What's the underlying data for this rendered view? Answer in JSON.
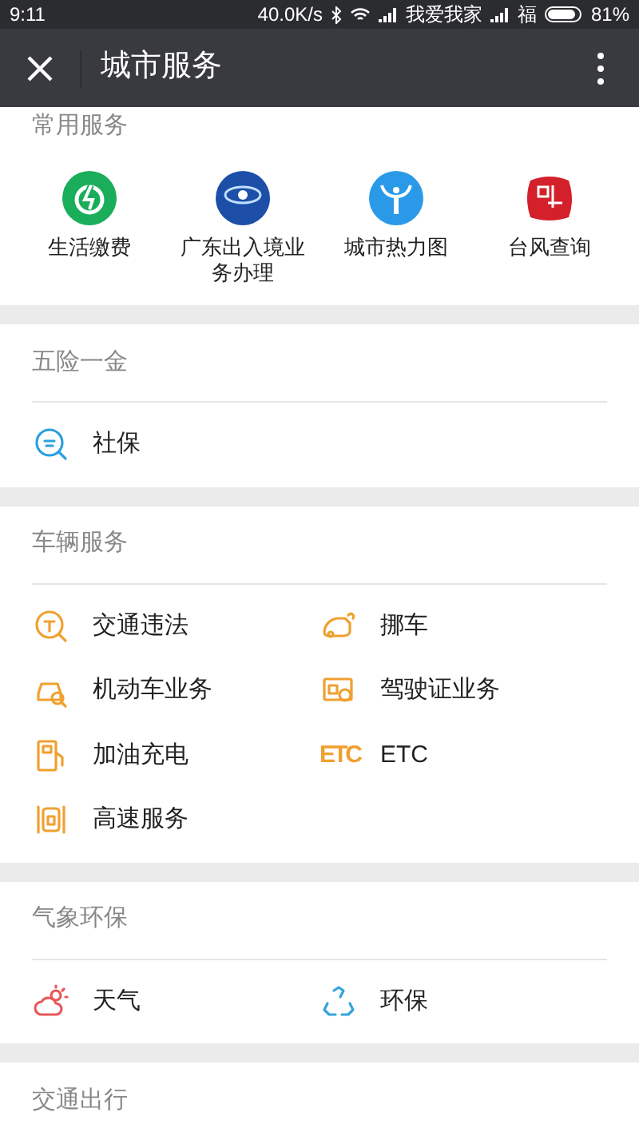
{
  "status_bar": {
    "time": "9:11",
    "speed": "40.0K/s",
    "carrier_1": "我爱我家",
    "carrier_2": "福",
    "battery": "81%"
  },
  "header": {
    "title": "城市服务"
  },
  "sections": [
    {
      "kind": "grid",
      "title": "常用服务",
      "items": [
        {
          "label": "生活缴费"
        },
        {
          "label": "广东出入境业务办理"
        },
        {
          "label": "城市热力图"
        },
        {
          "label": "台风查询"
        }
      ]
    },
    {
      "kind": "list",
      "title": "五险一金",
      "items": [
        {
          "label": "社保"
        }
      ]
    },
    {
      "kind": "list",
      "title": "车辆服务",
      "items": [
        {
          "label": "交通违法"
        },
        {
          "label": "挪车"
        },
        {
          "label": "机动车业务"
        },
        {
          "label": "驾驶证业务"
        },
        {
          "label": "加油充电"
        },
        {
          "label": "ETC",
          "icon_text": "ETC"
        },
        {
          "label": "高速服务"
        }
      ]
    },
    {
      "kind": "list",
      "title": "气象环保",
      "items": [
        {
          "label": "天气"
        },
        {
          "label": "环保"
        }
      ]
    },
    {
      "kind": "header",
      "title": "交通出行"
    }
  ]
}
